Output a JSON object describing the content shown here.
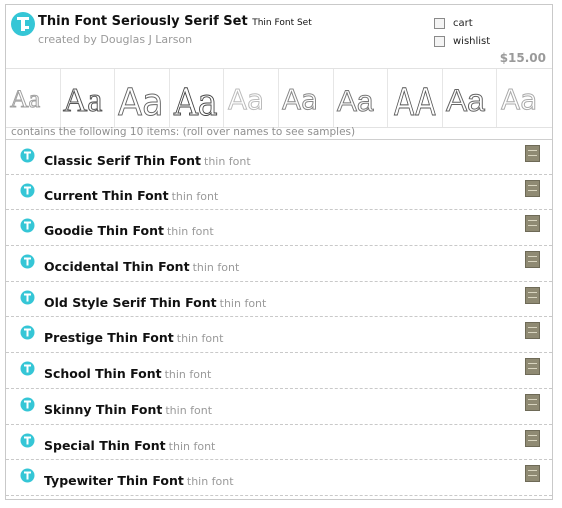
{
  "set": {
    "title": "Thin Font Seriously Serif Set",
    "subtitle": "Thin Font Set",
    "author": "created by Douglas J Larson",
    "price": "$15.00",
    "cart_label": "cart",
    "wishlist_label": "wishlist",
    "contains_text": "contains the following 10 items: (roll over names to see samples)",
    "icon": "font-set-icon",
    "samples": [
      "Aa",
      "Aa",
      "Aa",
      "Aa",
      "Aa",
      "Aa",
      "Aa",
      "AA",
      "Aa",
      "Aa"
    ]
  },
  "items": [
    {
      "name": "Classic Serif Thin Font",
      "type": "thin font",
      "icon": "font-icon",
      "preview_icon": "preview-icon"
    },
    {
      "name": "Current Thin Font",
      "type": "thin font",
      "icon": "font-icon",
      "preview_icon": "preview-icon"
    },
    {
      "name": "Goodie Thin Font",
      "type": "thin font",
      "icon": "font-icon",
      "preview_icon": "preview-icon"
    },
    {
      "name": "Occidental Thin Font",
      "type": "thin font",
      "icon": "font-icon",
      "preview_icon": "preview-icon"
    },
    {
      "name": "Old Style Serif Thin Font",
      "type": "thin font",
      "icon": "font-icon",
      "preview_icon": "preview-icon"
    },
    {
      "name": "Prestige Thin Font",
      "type": "thin font",
      "icon": "font-icon",
      "preview_icon": "preview-icon"
    },
    {
      "name": "School Thin Font",
      "type": "thin font",
      "icon": "font-icon",
      "preview_icon": "preview-icon"
    },
    {
      "name": "Skinny Thin Font",
      "type": "thin font",
      "icon": "font-icon",
      "preview_icon": "preview-icon"
    },
    {
      "name": "Special Thin Font",
      "type": "thin font",
      "icon": "font-icon",
      "preview_icon": "preview-icon"
    },
    {
      "name": "Typewiter Thin Font",
      "type": "thin font",
      "icon": "font-icon",
      "preview_icon": "preview-icon"
    }
  ],
  "colors": {
    "icon_cyan": "#35c6d6",
    "muted_text": "#9a9a9a",
    "preview_button": "#8f8a73"
  }
}
